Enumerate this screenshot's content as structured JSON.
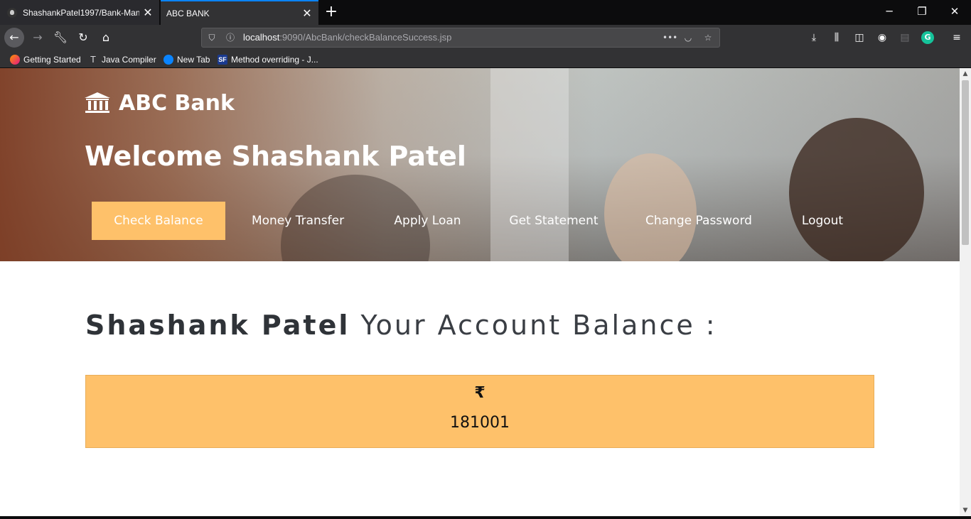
{
  "browser": {
    "tabs": [
      {
        "title": "ShashankPatel1997/Bank-Mana",
        "active": false
      },
      {
        "title": "ABC BANK",
        "active": true
      }
    ],
    "url": {
      "host": "localhost",
      "path": ":9090/AbcBank/checkBalanceSuccess.jsp"
    },
    "bookmarks": [
      "Getting Started",
      "Java Compiler",
      "New Tab",
      "Method overriding - J..."
    ],
    "accent_color": "#0a84ff"
  },
  "page": {
    "brand": "ABC Bank",
    "welcome": "Welcome Shashank Patel",
    "menu": [
      "Check Balance",
      "Money Transfer",
      "Apply Loan",
      "Get Statement",
      "Change Password",
      "Logout"
    ],
    "active_menu": "Check Balance",
    "title_name": "Shashank Patel",
    "title_rest": "Your Account Balance :",
    "currency_symbol": "₹",
    "balance": "181001",
    "colors": {
      "accent": "#fec16a",
      "text_dark": "#2f3338",
      "white": "#ffffff"
    }
  }
}
